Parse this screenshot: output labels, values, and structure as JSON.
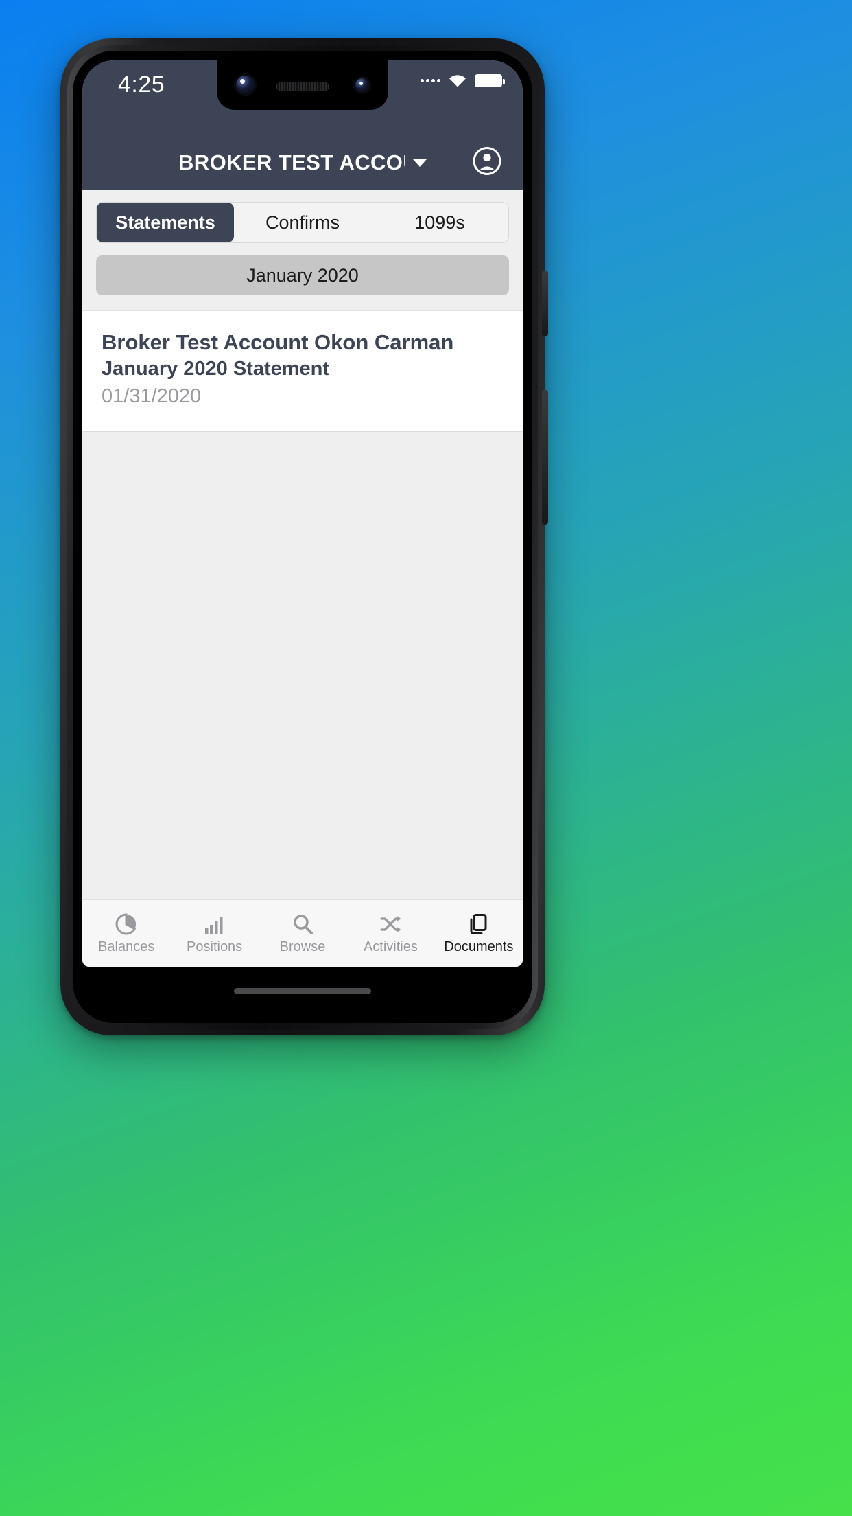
{
  "statusbar": {
    "time": "4:25",
    "signal_icon": "signal-dots-icon",
    "wifi_icon": "wifi-icon",
    "battery_icon": "battery-full-icon"
  },
  "header": {
    "title": "BROKER TEST ACCOU...",
    "dropdown_icon": "chevron-down-icon",
    "account_icon": "account-circle-icon",
    "background_color": "#3d4456"
  },
  "tabs": {
    "items": [
      {
        "label": "Statements",
        "active": true
      },
      {
        "label": "Confirms",
        "active": false
      },
      {
        "label": "1099s",
        "active": false
      }
    ],
    "active_color": "#3d4456"
  },
  "month_selector": {
    "value": "January 2020",
    "background_color": "#c6c6c6"
  },
  "statements": [
    {
      "account_name": "Broker Test Account Okon Carman",
      "document_title": "January 2020 Statement",
      "date": "01/31/2020"
    }
  ],
  "bottom_nav": {
    "items": [
      {
        "label": "Balances",
        "icon": "pie-chart-icon",
        "active": false
      },
      {
        "label": "Positions",
        "icon": "bar-chart-icon",
        "active": false
      },
      {
        "label": "Browse",
        "icon": "search-icon",
        "active": false
      },
      {
        "label": "Activities",
        "icon": "shuffle-icon",
        "active": false
      },
      {
        "label": "Documents",
        "icon": "documents-icon",
        "active": true
      }
    ],
    "active_color": "#1c1c1e",
    "inactive_color": "#9a9a9e"
  }
}
